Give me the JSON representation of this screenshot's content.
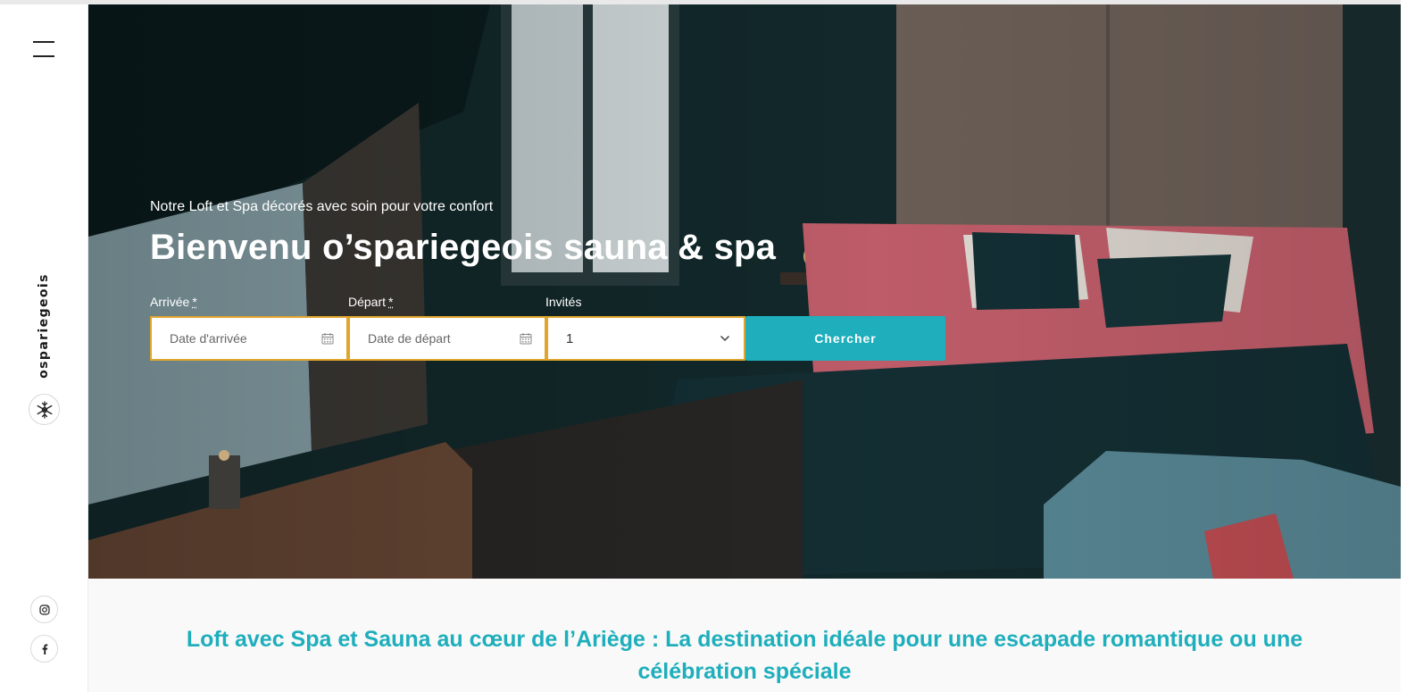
{
  "sidebar": {
    "brand": "ospariegeois",
    "menu_icon": "hamburger-icon",
    "logo_icon": "snowflake-logo-icon",
    "social": [
      {
        "icon": "instagram-icon"
      },
      {
        "icon": "facebook-icon"
      }
    ]
  },
  "hero": {
    "subtitle": "Notre Loft et Spa décorés avec soin pour votre confort",
    "title": "Bienvenu o’spariegeois sauna & spa"
  },
  "booking": {
    "arrival_label": "Arrivée",
    "departure_label": "Départ",
    "required_mark": "*",
    "guests_label": "Invités",
    "arrival_placeholder": "Date d'arrivée",
    "departure_placeholder": "Date de départ",
    "guests_value": "1",
    "search_label": "Chercher",
    "calendar_icon": "calendar-icon",
    "dropdown_icon": "chevron-down-icon"
  },
  "intro": {
    "heading": "Loft avec Spa et Sauna au cœur de l’Ariège : La destination idéale pour une escapade romantique ou une célébration spéciale"
  },
  "colors": {
    "accent": "#1eaebc",
    "field_border": "#e0a52c",
    "bed_cover": "#c8616e"
  }
}
